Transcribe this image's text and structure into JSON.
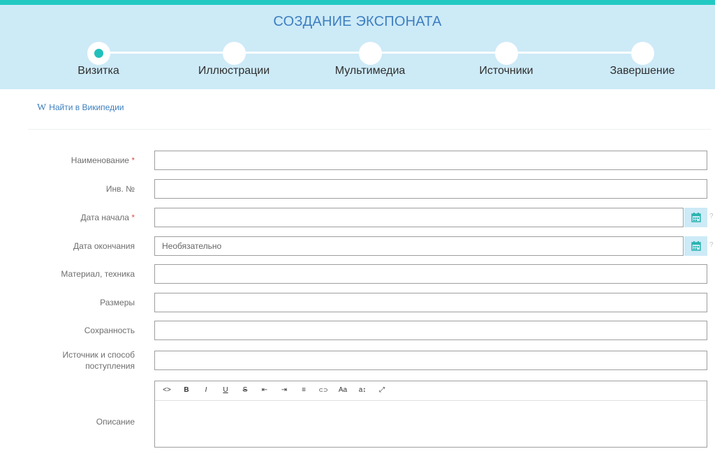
{
  "header": {
    "title": "СОЗДАНИЕ ЭКСПОНАТА",
    "steps": [
      {
        "label": "Визитка",
        "active": true
      },
      {
        "label": "Иллюстрации",
        "active": false
      },
      {
        "label": "Мультимедиа",
        "active": false
      },
      {
        "label": "Источники",
        "active": false
      },
      {
        "label": "Завершение",
        "active": false
      }
    ]
  },
  "wiki": {
    "glyph": "W",
    "label": "Найти в Википедии"
  },
  "form": {
    "name_label": "Наименование",
    "inv_label": "Инв. №",
    "start_label": "Дата начала",
    "end_label": "Дата окончания",
    "end_placeholder": "Необязательно",
    "material_label": "Материал, техника",
    "size_label": "Размеры",
    "condition_label": "Сохранность",
    "source_label": "Источник и способ поступления",
    "description_label": "Описание",
    "required_mark": "*",
    "help_mark": "?"
  },
  "editor_toolbar": [
    {
      "icon": "code-view-icon",
      "glyph": "<>"
    },
    {
      "icon": "bold-icon",
      "glyph": "B"
    },
    {
      "icon": "italic-icon",
      "glyph": "I"
    },
    {
      "icon": "underline-icon",
      "glyph": "U"
    },
    {
      "icon": "strikethrough-icon",
      "glyph": "S"
    },
    {
      "icon": "outdent-icon",
      "glyph": "⇤"
    },
    {
      "icon": "indent-icon",
      "glyph": "⇥"
    },
    {
      "icon": "align-left-icon",
      "glyph": "≡"
    },
    {
      "icon": "link-icon",
      "glyph": "⊂⊃"
    },
    {
      "icon": "font-size-icon",
      "glyph": "Aa"
    },
    {
      "icon": "line-height-icon",
      "glyph": "a↕"
    },
    {
      "icon": "fullscreen-icon",
      "glyph": "⤢"
    }
  ],
  "colors": {
    "accent": "#22c9c3",
    "header_bg": "#cdeaf7",
    "title_blue": "#3d7fbf",
    "required": "#d9534f"
  }
}
